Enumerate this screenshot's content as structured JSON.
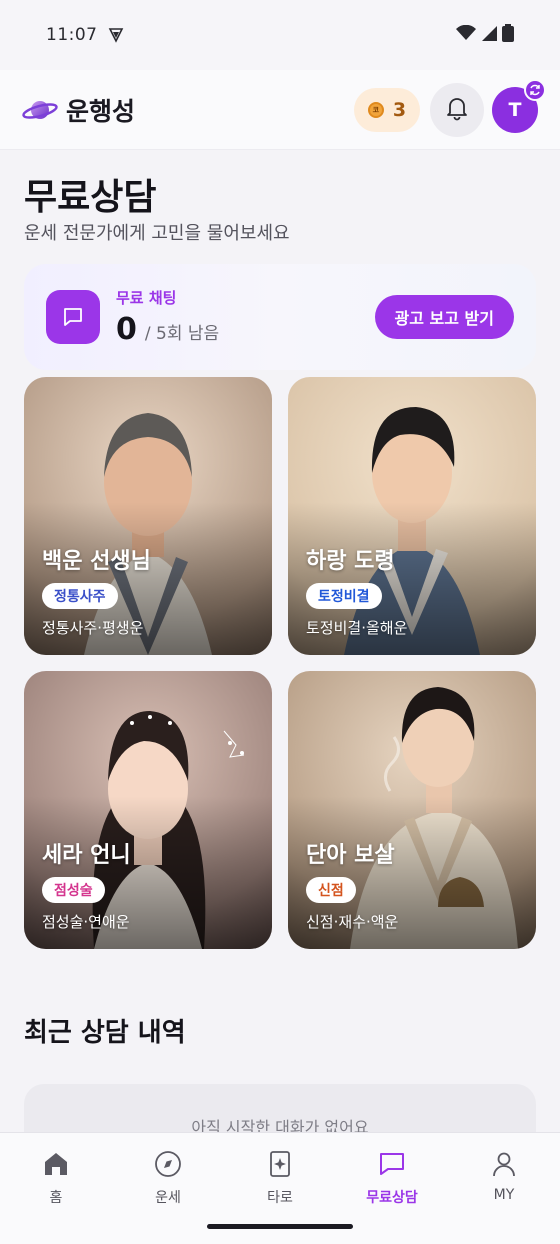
{
  "status_bar": {
    "time": "11:07"
  },
  "header": {
    "app_title": "운행성",
    "coin_count": "3",
    "coin_glyph": "코",
    "avatar_letter": "T"
  },
  "page": {
    "title": "무료상담",
    "subtitle": "운세 전문가에게 고민을 물어보세요"
  },
  "free_chat": {
    "label": "무료 채팅",
    "count": "0",
    "remaining": "/ 5회 남음",
    "ad_button": "광고 보고 받기"
  },
  "counselors": [
    {
      "name": "백운 선생님",
      "tag": "정통사주",
      "tag_color": "#3a4fc8",
      "desc": "정통사주·평생운"
    },
    {
      "name": "하랑 도령",
      "tag": "토정비결",
      "tag_color": "#2158d8",
      "desc": "토정비결·올해운"
    },
    {
      "name": "세라 언니",
      "tag": "점성술",
      "tag_color": "#d4358e",
      "desc": "점성술·연애운"
    },
    {
      "name": "단아 보살",
      "tag": "신점",
      "tag_color": "#d4541e",
      "desc": "신점·재수·액운"
    }
  ],
  "recent": {
    "title": "최근 상담 내역",
    "empty_text": "아직 시작한 대화가 없어요"
  },
  "nav": [
    {
      "label": "홈",
      "icon": "home-icon"
    },
    {
      "label": "운세",
      "icon": "compass-icon"
    },
    {
      "label": "타로",
      "icon": "tarot-card-icon"
    },
    {
      "label": "무료상담",
      "icon": "chat-icon",
      "active": true
    },
    {
      "label": "MY",
      "icon": "person-icon"
    }
  ],
  "colors": {
    "accent": "#9b36e8",
    "coin_bg": "#fdecd9"
  }
}
